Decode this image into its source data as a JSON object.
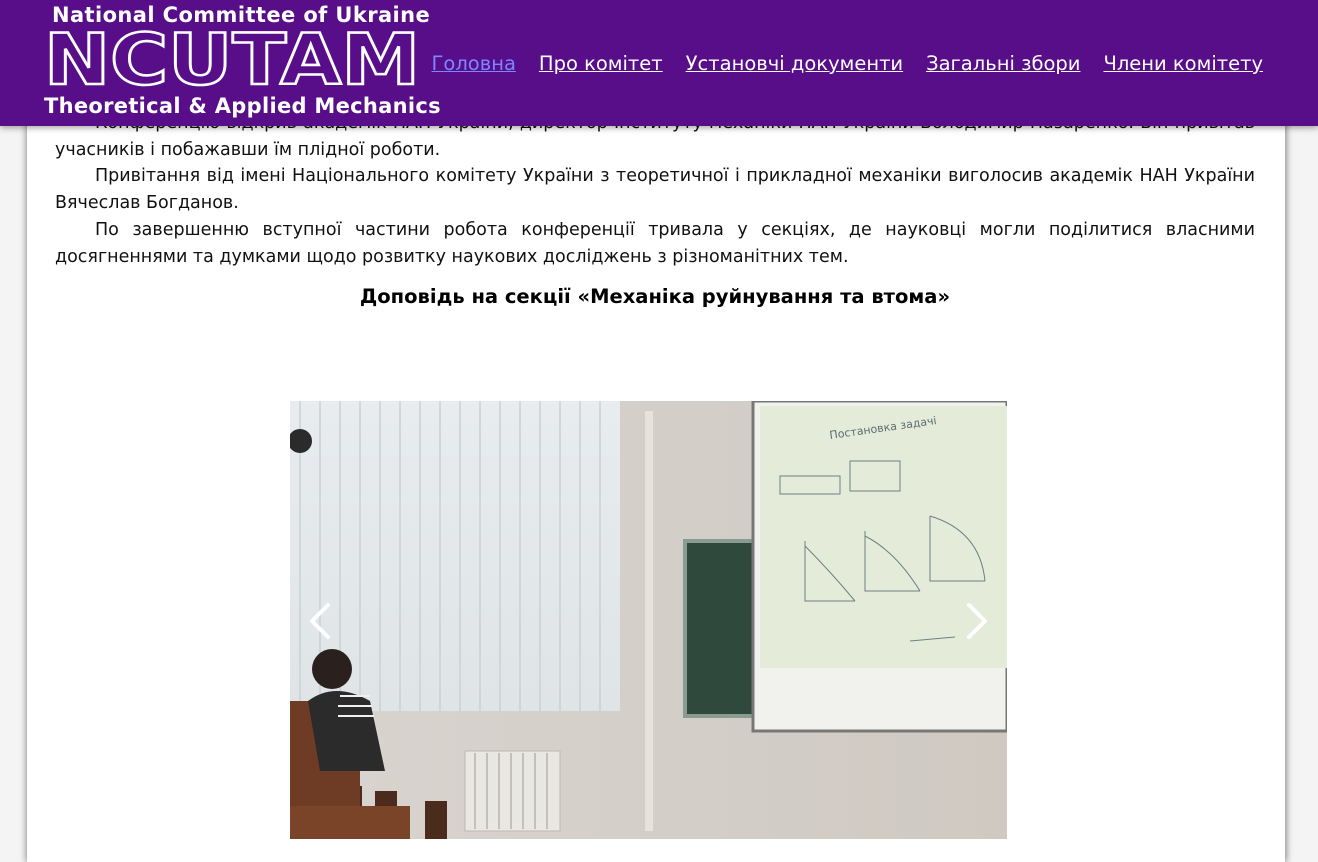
{
  "header": {
    "logo": {
      "top_line": "National Committee of Ukraine",
      "acronym": "NCUTAM",
      "bottom_line": "Theoretical & Applied Mechanics"
    },
    "nav": [
      {
        "label": "Головна",
        "active": true
      },
      {
        "label": "Про комітет",
        "active": false
      },
      {
        "label": "Установчі документи",
        "active": false
      },
      {
        "label": "Загальні збори",
        "active": false
      },
      {
        "label": "Члени комітету",
        "active": false
      }
    ],
    "colors": {
      "background": "#570e88",
      "active_link": "#7b86ff",
      "link": "#ffffff"
    }
  },
  "article": {
    "paragraphs": [
      "Конференцію відкрив академік НАН України, директор Інституту механіки НАН України Володимир Назаренко. Він привітав учасників і побажавши їм плідної роботи.",
      "Привітання від імені Національного комітету України з теоретичної і прикладної механіки виголосив академік НАН України Вячеслав Богданов.",
      "По завершенню вступної частини робота конференції тривала у секціях, де науковці могли поділитися власними досягненнями та думками щодо розвитку наукових досліджень з різноманітних тем."
    ],
    "section_title": "Доповідь на секції «Механіка руйнування та втома»"
  },
  "carousel": {
    "prev_icon": "chevron-left-icon",
    "next_icon": "chevron-right-icon",
    "slide": {
      "slide_title": "Постановка задачі"
    }
  }
}
